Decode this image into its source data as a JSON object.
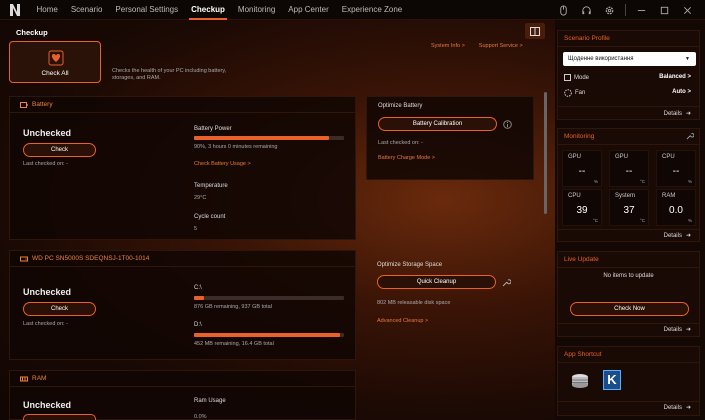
{
  "tabs": [
    "Home",
    "Scenario",
    "Personal Settings",
    "Checkup",
    "Monitoring",
    "App Center",
    "Experience Zone"
  ],
  "page_title": "Checkup",
  "check_all": {
    "label": "Check All",
    "description": "Checks the health of your PC including battery, storages, and RAM."
  },
  "top_links": {
    "system_info": "System Info >",
    "support": "Support Service >"
  },
  "battery": {
    "title": "Battery",
    "status": "Unchecked",
    "check": "Check",
    "last_checked": "Last checked on: -",
    "power_label": "Battery Power",
    "power_fraction": 0.9,
    "power_text": "90%, 3 hours 0 minutes remaining",
    "usage_link": "Check Battery Usage >",
    "temp_label": "Temperature",
    "temp": "29°C",
    "cycle_label": "Cycle count",
    "cycle": "5"
  },
  "optimize_battery": {
    "title": "Optimize Battery",
    "calibration": "Battery Calibration",
    "last_checked": "Last checked on: -",
    "charge_mode": "Battery Charge Mode >"
  },
  "storage": {
    "title": "WD PC SN5000S SDEQNSJ-1T00-1014",
    "status": "Unchecked",
    "check": "Check",
    "last_checked": "Last checked on: -",
    "drives": [
      {
        "name": "C:\\",
        "fraction": 0.065,
        "text": "876 GB remaining, 937 GB total"
      },
      {
        "name": "D:\\",
        "fraction": 0.97,
        "text": "452 MB remaining, 16.4 GB total"
      }
    ]
  },
  "optimize_storage": {
    "title": "Optimize Storage Space",
    "cleanup": "Quick Cleanup",
    "releasable": "802 MB releasable disk space",
    "advanced": "Advanced Cleanup >"
  },
  "ram": {
    "title": "RAM",
    "status": "Unchecked",
    "usage_label": "Ram Usage",
    "usage": "0.0%"
  },
  "scenario": {
    "header": "Scenario Profile",
    "profile": "Щоденне використання",
    "mode_label": "Mode",
    "mode_value": "Balanced >",
    "fan_label": "Fan",
    "fan_value": "Auto >",
    "details": "Details"
  },
  "monitoring": {
    "header": "Monitoring",
    "items": [
      {
        "name": "GPU",
        "value": "--",
        "unit": "%"
      },
      {
        "name": "GPU",
        "value": "--",
        "unit": "°C"
      },
      {
        "name": "CPU",
        "value": "--",
        "unit": "%"
      },
      {
        "name": "CPU",
        "value": "39",
        "unit": "°C"
      },
      {
        "name": "System",
        "value": "37",
        "unit": "°C"
      },
      {
        "name": "RAM",
        "value": "0.0",
        "unit": "%"
      }
    ],
    "details": "Details"
  },
  "live_update": {
    "header": "Live Update",
    "message": "No items to update",
    "check_now": "Check Now",
    "details": "Details"
  },
  "app_shortcut": {
    "header": "App Shortcut",
    "details": "Details"
  },
  "accent": "#e8602a"
}
